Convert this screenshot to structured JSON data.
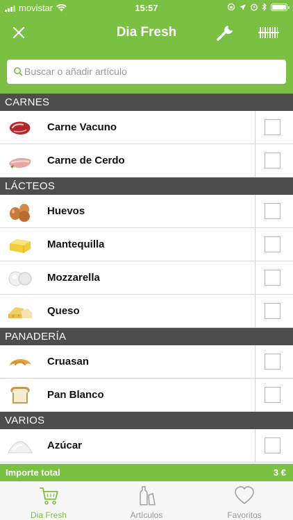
{
  "status_bar": {
    "carrier": "movistar",
    "time": "15:57"
  },
  "navbar": {
    "title": "Dia Fresh"
  },
  "search": {
    "placeholder": "Buscar o añadir artículo"
  },
  "sections": [
    {
      "title": "CARNES",
      "items": [
        {
          "name": "Carne Vacuno",
          "icon": "beef-steak-icon"
        },
        {
          "name": "Carne de Cerdo",
          "icon": "pork-loin-icon"
        }
      ]
    },
    {
      "title": "LÁCTEOS",
      "items": [
        {
          "name": "Huevos",
          "icon": "eggs-icon"
        },
        {
          "name": "Mantequilla",
          "icon": "butter-icon"
        },
        {
          "name": "Mozzarella",
          "icon": "mozzarella-icon"
        },
        {
          "name": "Queso",
          "icon": "cheese-icon"
        }
      ]
    },
    {
      "title": "PANADERÍA",
      "items": [
        {
          "name": "Cruasan",
          "icon": "croissant-icon"
        },
        {
          "name": "Pan Blanco",
          "icon": "white-bread-icon"
        }
      ]
    },
    {
      "title": "VARIOS",
      "items": [
        {
          "name": "Azúcar",
          "icon": "sugar-icon"
        }
      ]
    }
  ],
  "total": {
    "label": "Importe total",
    "value": "3 €"
  },
  "tabs": [
    {
      "label": "Dia Fresh",
      "icon": "shopping-cart-icon",
      "active": true
    },
    {
      "label": "Artículos",
      "icon": "bottle-icon",
      "active": false
    },
    {
      "label": "Favoritos",
      "icon": "heart-icon",
      "active": false
    }
  ],
  "colors": {
    "brand_green": "#7ac143",
    "section_gray": "#4d4d4d"
  }
}
